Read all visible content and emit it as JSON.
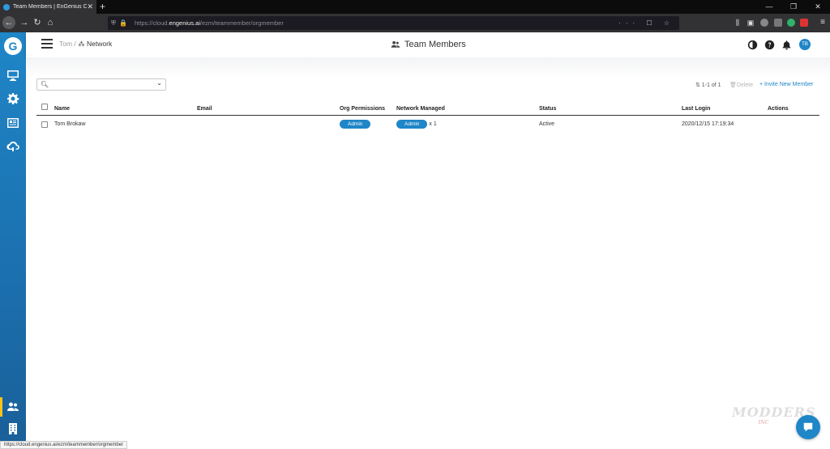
{
  "browser": {
    "tab_title": "Team Members | EnGenius Clo",
    "tab_close": "✕",
    "new_tab": "+",
    "url_prefix": "https://cloud.",
    "url_domain": "engenius.ai",
    "url_path": "/ezm/teammember/orgmember",
    "status_url": "https://cloud.engenius.ai/ezm/teammember/orgmember",
    "window_controls": [
      "—",
      "❐",
      "✕"
    ],
    "menu": "≡"
  },
  "header": {
    "breadcrumb_parent": "Tom /",
    "breadcrumb_current": "Network",
    "title": "Team Members",
    "avatar_initials": "TB"
  },
  "toolbar": {
    "pager": "⇅ 1-1 of 1",
    "delete_label": "Delete",
    "invite_label": "+ Invite New Member"
  },
  "table": {
    "columns": [
      "Name",
      "Email",
      "Org Permissions",
      "Network Managed",
      "Status",
      "Last Login",
      "Actions"
    ],
    "rows": [
      {
        "name": "Tom Brokaw",
        "email": "",
        "org_permission": "Admin",
        "network_role": "Admin",
        "network_count": "x 1",
        "status": "Active",
        "last_login": "2020/12/15 17:19:34",
        "actions": ""
      }
    ]
  },
  "watermark": {
    "text": "MODDERS",
    "sub": "INC"
  },
  "colors": {
    "brand": "#1f86c7",
    "sidebar_top": "#1f86c7",
    "sidebar_bottom": "#1a5f98",
    "active_indicator": "#f7c21a"
  },
  "icons": {
    "sidebar": [
      "monitor-icon",
      "gear-icon",
      "list-icon",
      "cloud-network-icon",
      "team-icon",
      "building-icon"
    ],
    "header": [
      "contrast-icon",
      "help-icon",
      "bell-icon"
    ]
  }
}
